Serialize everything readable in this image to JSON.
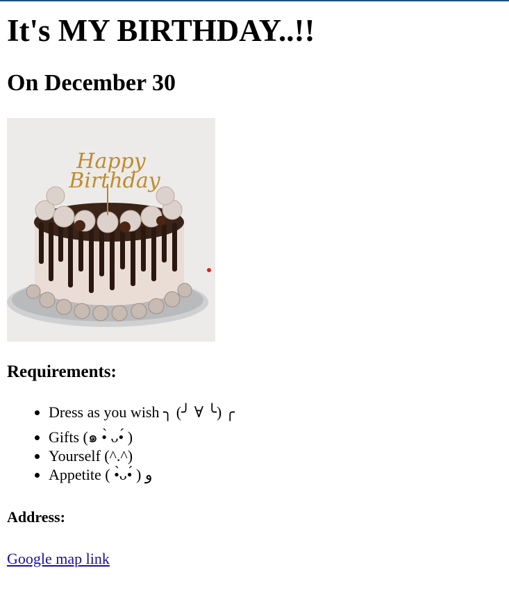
{
  "page": {
    "title": "It's MY BIRTHDAY..!!",
    "date_heading": "On December 30",
    "cake_image": {
      "topper_line1": "Happy",
      "topper_line2": "Birthday"
    },
    "requirements_heading": "Requirements:",
    "requirements": [
      "Dress as you wish ╮ (╯ ∀ ╰) ╭",
      "Gifts (๑ •̀ ᴗ•́ )",
      "Yourself (^.^)",
      "Appetite ( •̀ᴗ•́ ) و"
    ],
    "address_heading": "Address:",
    "map_link_label": "Google map link"
  },
  "colors": {
    "top_border": "#1f4e79",
    "link": "#1a0dab",
    "red_dot": "#e5201a"
  }
}
